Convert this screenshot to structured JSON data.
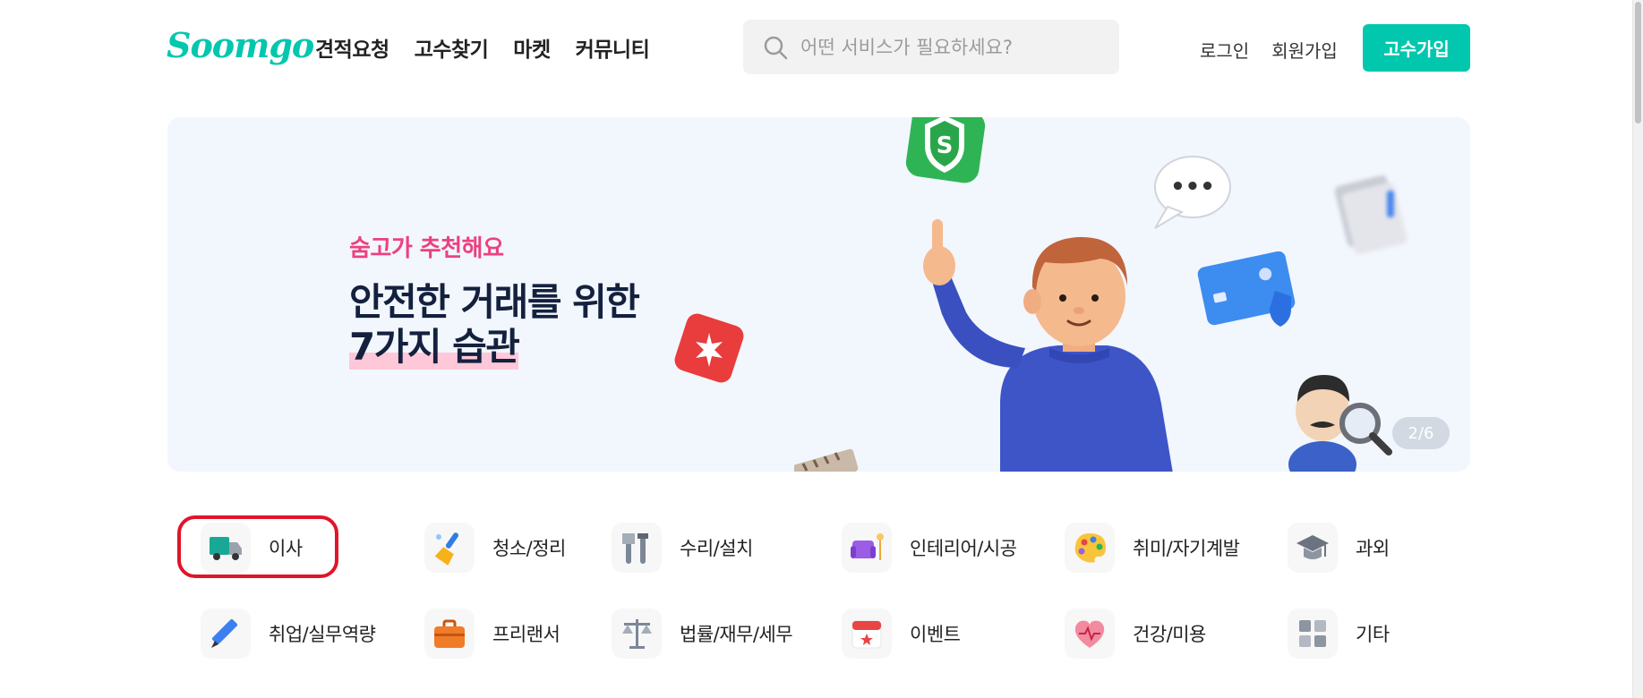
{
  "header": {
    "logo": "Soomgo",
    "nav": [
      "견적요청",
      "고수찾기",
      "마켓",
      "커뮤니티"
    ],
    "search_placeholder": "어떤 서비스가 필요하세요?",
    "login": "로그인",
    "signup": "회원가입",
    "pro_signup": "고수가입"
  },
  "banner": {
    "subtitle": "숨고가 추천해요",
    "title_line1": "안전한 거래를 위한",
    "title_line2": "7가지 습관",
    "pager": "2/6",
    "shield_letter": "S",
    "bubble_text": "•••"
  },
  "categories": [
    {
      "label": "이사",
      "icon": "moving-truck-icon"
    },
    {
      "label": "청소/정리",
      "icon": "cleaning-brush-icon"
    },
    {
      "label": "수리/설치",
      "icon": "repair-tools-icon"
    },
    {
      "label": "인테리어/시공",
      "icon": "interior-sofa-icon"
    },
    {
      "label": "취미/자기계발",
      "icon": "hobby-palette-icon"
    },
    {
      "label": "과외",
      "icon": "tutoring-cap-icon"
    },
    {
      "label": "취업/실무역량",
      "icon": "career-pencil-icon"
    },
    {
      "label": "프리랜서",
      "icon": "freelancer-briefcase-icon"
    },
    {
      "label": "법률/재무/세무",
      "icon": "legal-scale-icon"
    },
    {
      "label": "이벤트",
      "icon": "event-calendar-icon"
    },
    {
      "label": "건강/미용",
      "icon": "health-heart-icon"
    },
    {
      "label": "기타",
      "icon": "etc-grid-icon"
    }
  ],
  "highlight": {
    "target": "이사",
    "color": "#e0142a"
  },
  "colors": {
    "brand": "#00c7ae",
    "accent_pink": "#ec4180",
    "banner_bg": "#f2f6fd",
    "title_navy": "#14213e"
  }
}
